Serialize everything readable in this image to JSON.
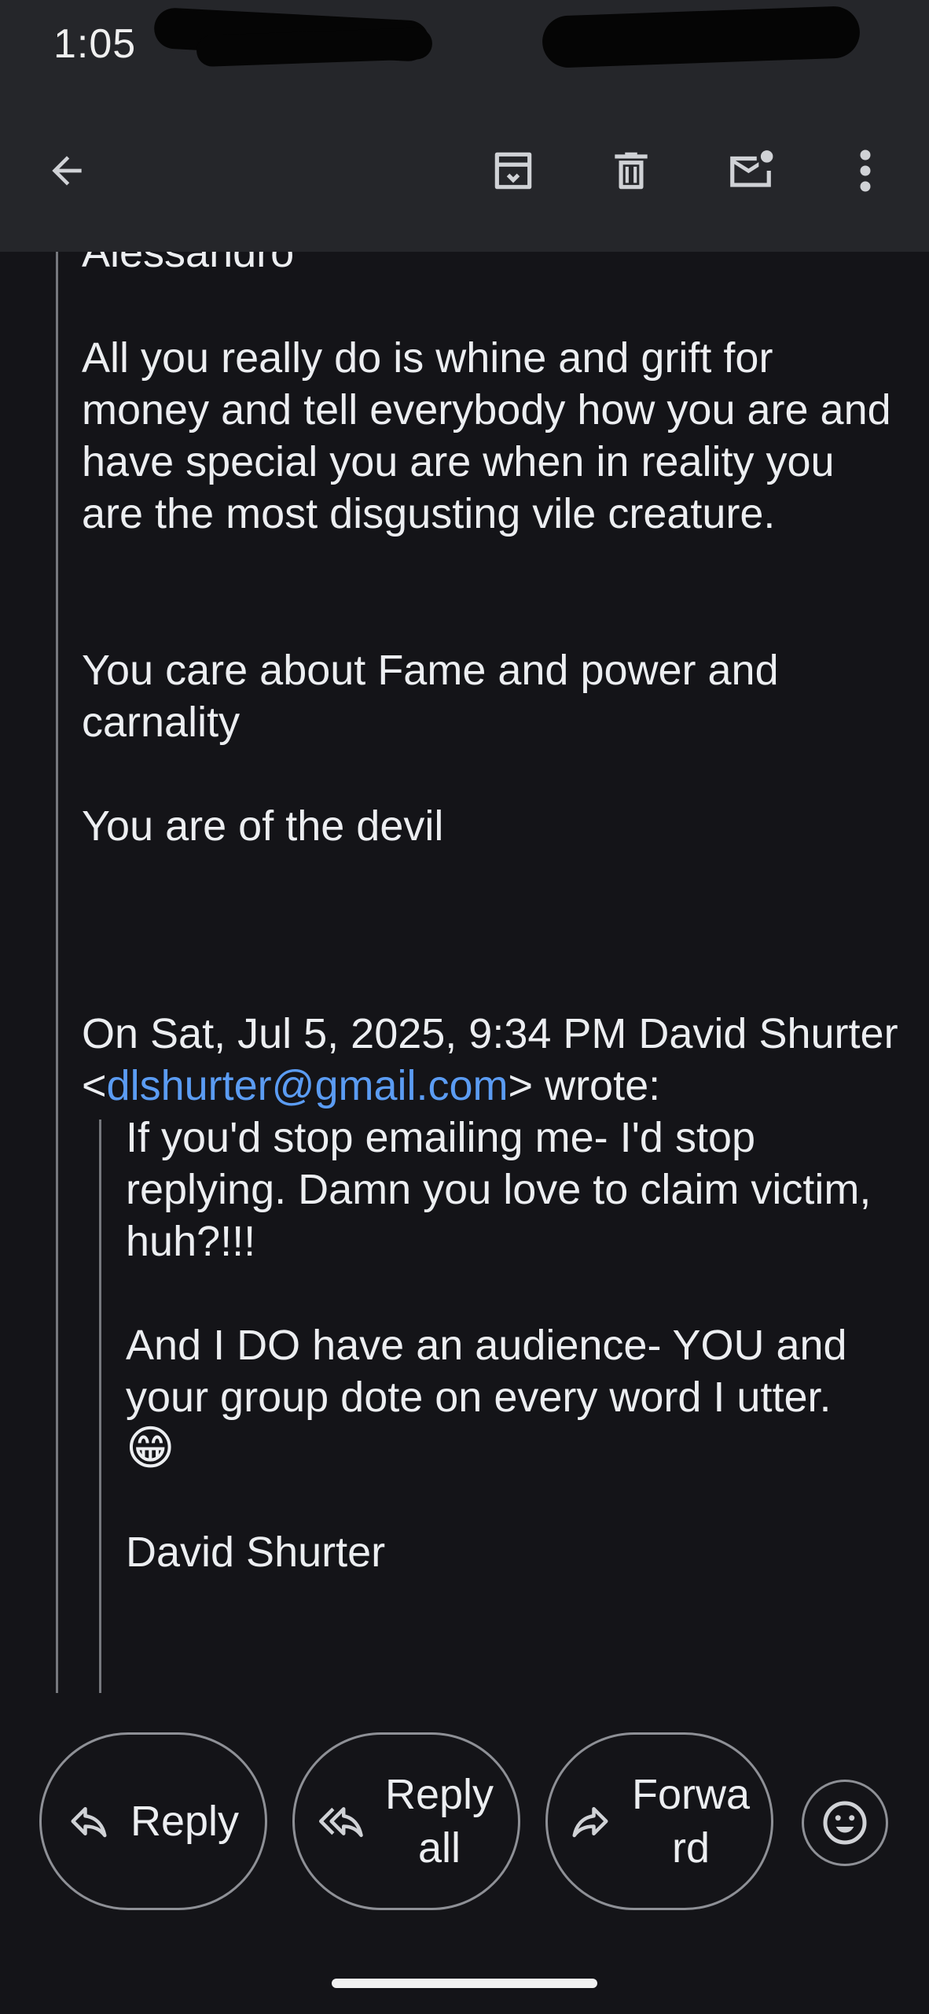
{
  "status_bar": {
    "time": "1:05"
  },
  "toolbar": {
    "back_icon": "arrow-back-icon",
    "archive_icon": "archive-icon",
    "delete_icon": "trash-icon",
    "mark_unread_icon": "mark-unread-icon",
    "more_icon": "more-vert-icon"
  },
  "message": {
    "cut_line": "Alessandro",
    "para1": "All you really do is whine and grift for money and tell everybody how you are and have special you are when in reality you are the most disgusting vile creature.",
    "para2": "You care about Fame and power and carnality",
    "para3": "You are of the devil",
    "quote_header_prefix": "On Sat, Jul 5, 2025, 9:34 PM David Shurter <",
    "quote_header_email": "dlshurter@gmail.com",
    "quote_header_suffix": "> wrote:",
    "quoted": {
      "para1": "If you'd stop emailing me- I'd stop replying. Damn you love to claim victim, huh?!!!",
      "para2": "And I DO have an audience- YOU and your group dote on every word I utter.",
      "emoji": "😁",
      "signature": "David Shurter"
    }
  },
  "actions": {
    "reply": "Reply",
    "reply_all_line1": "Reply",
    "reply_all_line2": "all",
    "forward_line1": "Forwa",
    "forward_line2": "rd",
    "emoji_icon": "smiley-icon"
  },
  "colors": {
    "background": "#141418",
    "toolbar": "#25262a",
    "link": "#5b9cf3"
  }
}
